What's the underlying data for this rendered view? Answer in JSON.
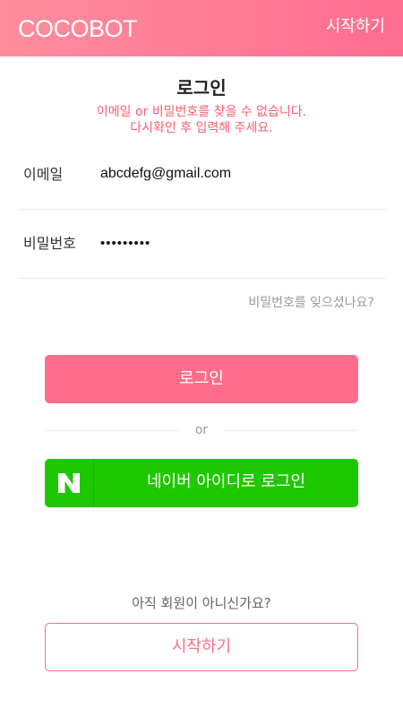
{
  "header": {
    "logo": "COCOBOT",
    "start_link": "시작하기"
  },
  "page": {
    "title": "로그인",
    "error_line1": "이메일 or 비밀번호를 찾을 수 없습니다.",
    "error_line2": "다시확인 후 입력해 주세요."
  },
  "form": {
    "email_label": "이메일",
    "email_value": "abcdefg@gmail.com",
    "password_label": "비밀번호",
    "password_value": "•••••••••",
    "forgot_password": "비밀번호를 잊으셨나요?"
  },
  "actions": {
    "login_button": "로그인",
    "or_text": "or",
    "naver_button": "네이버 아이디로 로그인",
    "naver_icon": "naver-n-icon"
  },
  "signup": {
    "prompt": "아직 회원이 아니신가요?",
    "start_button": "시작하기"
  },
  "colors": {
    "brand_pink": "#ff6d8a",
    "naver_green": "#1ec800",
    "error_red": "#ff5c6f"
  }
}
